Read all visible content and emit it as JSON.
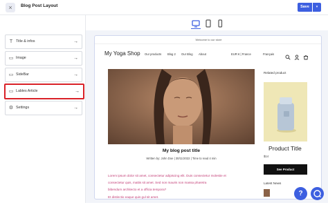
{
  "topbar": {
    "page_name": "Blog Post Layout",
    "save_label": "Save",
    "close_glyph": "×",
    "caret_glyph": "▾"
  },
  "device_toggle": [
    "desktop-icon",
    "tablet-icon",
    "mobile-icon"
  ],
  "sidebar": {
    "items": [
      {
        "label": "Title & infos",
        "icon": "T"
      },
      {
        "label": "Image",
        "icon": "▭"
      },
      {
        "label": "SideBar",
        "icon": "▭"
      },
      {
        "label": "Lables Article",
        "icon": "▭"
      },
      {
        "label": "Settings",
        "icon": "⚙"
      }
    ],
    "arrow": "→"
  },
  "preview": {
    "announcement": "Welcome to our store",
    "brand": "My Yoga Shop",
    "nav": [
      "Our products",
      "Blog 2",
      "Our Blog",
      "About"
    ],
    "currency": "EUR € | France",
    "language": "Français",
    "post_title": "My blog post title",
    "post_meta": "Written by: John Doe  |  30/11/2022  |  Time to read 4 min",
    "post_body": [
      "Lorem ipsum dolor sit amet, consectetur adipiscing elit. Duis consectetur molestie et",
      "consectetur quis, mattis sit amet. Sed non mauris non massa pharetra",
      "bibendum architecto et a officia tempora?",
      "Et distinctio eaque quis gul sit amet."
    ],
    "related_title": "Related product",
    "product_name": "Product Title",
    "product_price": "$14",
    "product_button": "See Product",
    "news_title": "Latest News"
  },
  "fabs": [
    "?",
    "◯"
  ],
  "colors": {
    "accent": "#3d5fe0",
    "highlight": "#d92027",
    "body_text": "#c23a74"
  }
}
